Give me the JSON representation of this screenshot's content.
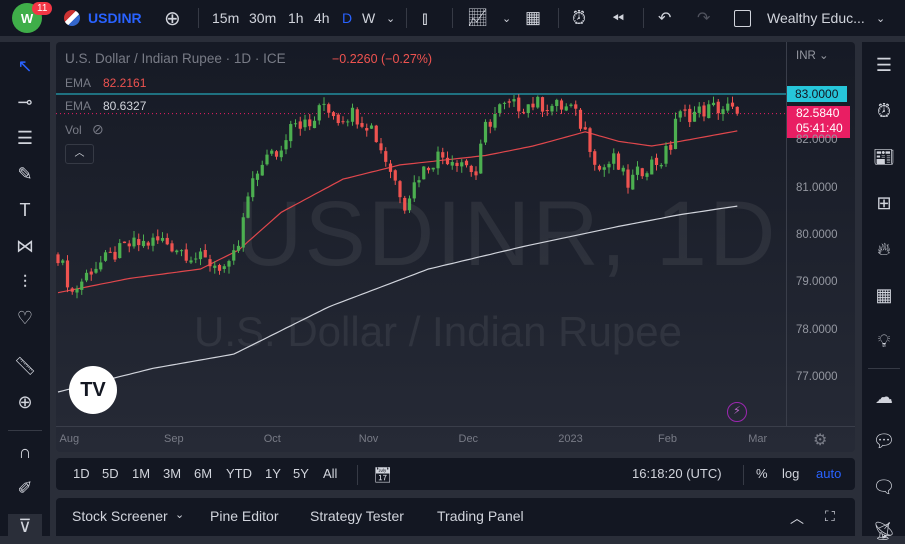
{
  "header": {
    "notification_count": "11",
    "symbol": "USDINR",
    "intervals": [
      "15m",
      "30m",
      "1h",
      "4h",
      "D",
      "W"
    ],
    "active_interval": "D",
    "layout_name": "Wealthy Educ..."
  },
  "chart": {
    "title": "U.S. Dollar / Indian Rupee · 1D · ICE",
    "change": "−0.2260 (−0.27%)",
    "ema_label": "EMA",
    "ema1_value": "82.2161",
    "ema2_value": "80.6327",
    "vol_label": "Vol",
    "watermark_symbol": "USDINR, 1D",
    "watermark_name": "U.S. Dollar / Indian Rupee",
    "currency": "INR",
    "colors": {
      "up": "#4caf50",
      "down": "#ef5350",
      "ema50": "#e0474c",
      "ema200": "#d1d4dc",
      "resistance": "#26c6da",
      "last_price": "#e91e63"
    }
  },
  "chart_data": {
    "type": "candlestick",
    "title": "U.S. Dollar / Indian Rupee · 1D · ICE",
    "x_tick_labels": [
      "Aug",
      "Sep",
      "Oct",
      "Nov",
      "Dec",
      "2023",
      "Feb",
      "Mar"
    ],
    "x_tick_index": [
      2,
      24,
      45,
      65,
      86,
      107,
      128,
      147
    ],
    "y_tick_labels": [
      "82.0000",
      "81.0000",
      "80.0000",
      "79.0000",
      "78.0000",
      "77.0000"
    ],
    "y_ticks": [
      82,
      81,
      80,
      79,
      78,
      77
    ],
    "ylim": [
      76.2,
      84.1
    ],
    "resistance_level": 83.0,
    "resistance_label": "83.0000",
    "last_price": 82.584,
    "last_price_label": "82.5840",
    "countdown": "05:41:40",
    "num_candles": 144,
    "close_keypoints": [
      [
        0,
        79.6
      ],
      [
        3,
        78.8
      ],
      [
        7,
        79.3
      ],
      [
        15,
        79.8
      ],
      [
        22,
        79.9
      ],
      [
        30,
        79.5
      ],
      [
        36,
        79.3
      ],
      [
        38,
        79.8
      ],
      [
        40,
        80.8
      ],
      [
        43,
        81.6
      ],
      [
        47,
        81.8
      ],
      [
        49,
        82.5
      ],
      [
        53,
        82.3
      ],
      [
        56,
        82.8
      ],
      [
        59,
        82.5
      ],
      [
        62,
        82.6
      ],
      [
        66,
        82.3
      ],
      [
        70,
        81.4
      ],
      [
        73,
        80.7
      ],
      [
        76,
        81.3
      ],
      [
        80,
        81.7
      ],
      [
        85,
        81.6
      ],
      [
        88,
        81.3
      ],
      [
        90,
        82.3
      ],
      [
        93,
        82.7
      ],
      [
        100,
        82.8
      ],
      [
        108,
        82.7
      ],
      [
        111,
        82.2
      ],
      [
        114,
        81.4
      ],
      [
        117,
        81.6
      ],
      [
        120,
        81.1
      ],
      [
        124,
        81.5
      ],
      [
        127,
        81.6
      ],
      [
        129,
        81.9
      ],
      [
        130,
        82.5
      ],
      [
        134,
        82.6
      ],
      [
        138,
        82.7
      ],
      [
        141,
        82.7
      ],
      [
        143,
        82.58
      ]
    ],
    "ema50_keypoints": [
      [
        0,
        78.8
      ],
      [
        15,
        79.1
      ],
      [
        30,
        79.3
      ],
      [
        38,
        79.7
      ],
      [
        47,
        80.5
      ],
      [
        60,
        81.2
      ],
      [
        72,
        81.5
      ],
      [
        90,
        81.7
      ],
      [
        100,
        81.9
      ],
      [
        111,
        82.2
      ],
      [
        118,
        82.0
      ],
      [
        125,
        81.9
      ],
      [
        131,
        82.0
      ],
      [
        143,
        82.22
      ]
    ],
    "ema200_keypoints": [
      [
        0,
        76.7
      ],
      [
        20,
        77.2
      ],
      [
        37,
        77.5
      ],
      [
        57,
        78.5
      ],
      [
        78,
        79.3
      ],
      [
        99,
        79.8
      ],
      [
        118,
        80.2
      ],
      [
        131,
        80.45
      ],
      [
        143,
        80.63
      ]
    ]
  },
  "ranges": [
    "1D",
    "5D",
    "1M",
    "3M",
    "6M",
    "YTD",
    "1Y",
    "5Y",
    "All"
  ],
  "status": {
    "time": "16:18:20 (UTC)",
    "percent": "%",
    "log": "log",
    "auto": "auto"
  },
  "bottom_tabs": [
    "Stock Screener",
    "Pine Editor",
    "Strategy Tester",
    "Trading Panel"
  ]
}
